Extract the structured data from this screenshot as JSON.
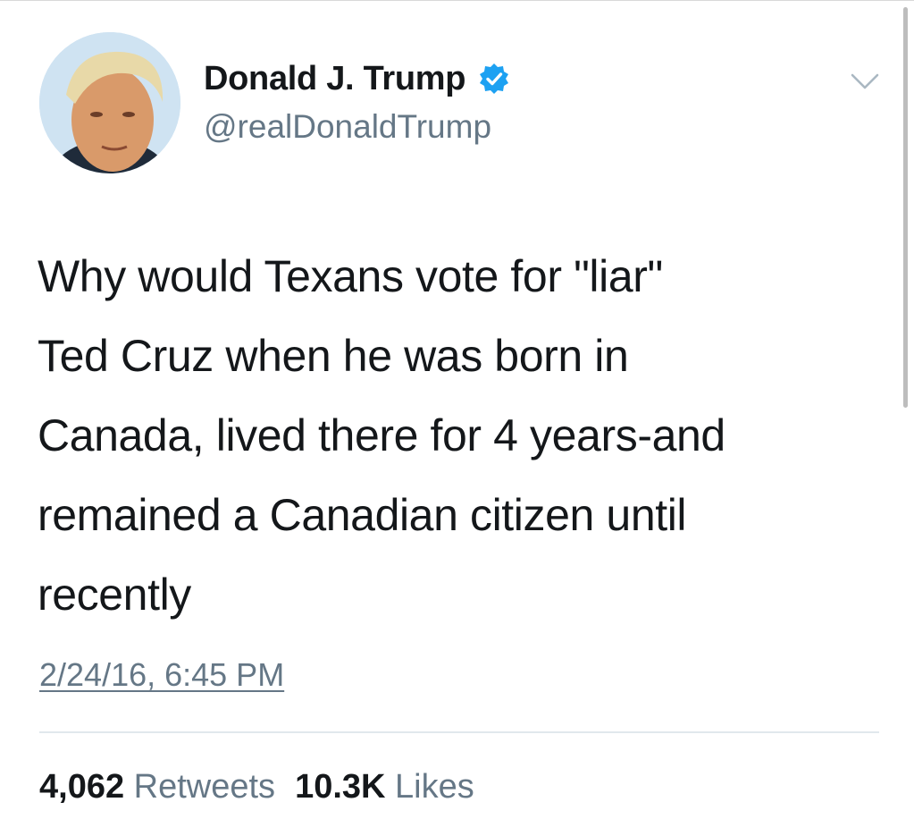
{
  "author": {
    "display_name": "Donald J. Trump",
    "handle": "@realDonaldTrump",
    "verified": true,
    "verified_icon": "verified-badge-icon",
    "verified_color": "#1da1f2"
  },
  "tweet": {
    "lines": [
      "Why would Texans vote for \"liar\"",
      "Ted Cruz when he was born in",
      "Canada, lived there for 4 years-and",
      "remained a Canadian citizen until",
      "recently"
    ],
    "timestamp": "2/24/16, 6:45 PM"
  },
  "stats": {
    "retweets_count": "4,062",
    "retweets_label": "Retweets",
    "likes_count": "10.3K",
    "likes_label": "Likes"
  },
  "icons": {
    "menu": "chevron-down-icon",
    "avatar": "avatar"
  },
  "colors": {
    "text": "#14171a",
    "secondary_text": "#657786",
    "divider": "#e1e8ed"
  }
}
